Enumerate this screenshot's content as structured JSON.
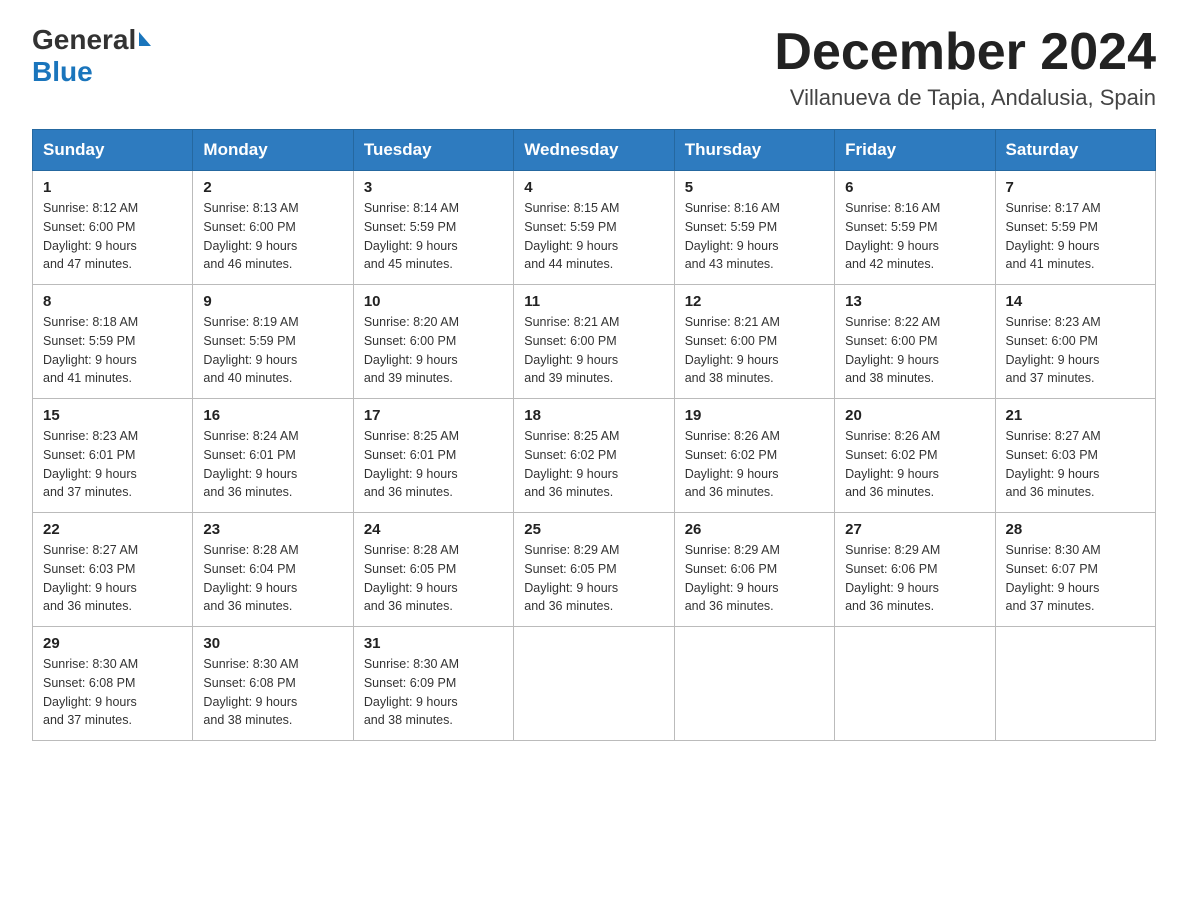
{
  "header": {
    "logo_general": "General",
    "logo_blue": "Blue",
    "month_title": "December 2024",
    "location": "Villanueva de Tapia, Andalusia, Spain"
  },
  "columns": [
    "Sunday",
    "Monday",
    "Tuesday",
    "Wednesday",
    "Thursday",
    "Friday",
    "Saturday"
  ],
  "weeks": [
    [
      {
        "day": "1",
        "info": "Sunrise: 8:12 AM\nSunset: 6:00 PM\nDaylight: 9 hours\nand 47 minutes."
      },
      {
        "day": "2",
        "info": "Sunrise: 8:13 AM\nSunset: 6:00 PM\nDaylight: 9 hours\nand 46 minutes."
      },
      {
        "day": "3",
        "info": "Sunrise: 8:14 AM\nSunset: 5:59 PM\nDaylight: 9 hours\nand 45 minutes."
      },
      {
        "day": "4",
        "info": "Sunrise: 8:15 AM\nSunset: 5:59 PM\nDaylight: 9 hours\nand 44 minutes."
      },
      {
        "day": "5",
        "info": "Sunrise: 8:16 AM\nSunset: 5:59 PM\nDaylight: 9 hours\nand 43 minutes."
      },
      {
        "day": "6",
        "info": "Sunrise: 8:16 AM\nSunset: 5:59 PM\nDaylight: 9 hours\nand 42 minutes."
      },
      {
        "day": "7",
        "info": "Sunrise: 8:17 AM\nSunset: 5:59 PM\nDaylight: 9 hours\nand 41 minutes."
      }
    ],
    [
      {
        "day": "8",
        "info": "Sunrise: 8:18 AM\nSunset: 5:59 PM\nDaylight: 9 hours\nand 41 minutes."
      },
      {
        "day": "9",
        "info": "Sunrise: 8:19 AM\nSunset: 5:59 PM\nDaylight: 9 hours\nand 40 minutes."
      },
      {
        "day": "10",
        "info": "Sunrise: 8:20 AM\nSunset: 6:00 PM\nDaylight: 9 hours\nand 39 minutes."
      },
      {
        "day": "11",
        "info": "Sunrise: 8:21 AM\nSunset: 6:00 PM\nDaylight: 9 hours\nand 39 minutes."
      },
      {
        "day": "12",
        "info": "Sunrise: 8:21 AM\nSunset: 6:00 PM\nDaylight: 9 hours\nand 38 minutes."
      },
      {
        "day": "13",
        "info": "Sunrise: 8:22 AM\nSunset: 6:00 PM\nDaylight: 9 hours\nand 38 minutes."
      },
      {
        "day": "14",
        "info": "Sunrise: 8:23 AM\nSunset: 6:00 PM\nDaylight: 9 hours\nand 37 minutes."
      }
    ],
    [
      {
        "day": "15",
        "info": "Sunrise: 8:23 AM\nSunset: 6:01 PM\nDaylight: 9 hours\nand 37 minutes."
      },
      {
        "day": "16",
        "info": "Sunrise: 8:24 AM\nSunset: 6:01 PM\nDaylight: 9 hours\nand 36 minutes."
      },
      {
        "day": "17",
        "info": "Sunrise: 8:25 AM\nSunset: 6:01 PM\nDaylight: 9 hours\nand 36 minutes."
      },
      {
        "day": "18",
        "info": "Sunrise: 8:25 AM\nSunset: 6:02 PM\nDaylight: 9 hours\nand 36 minutes."
      },
      {
        "day": "19",
        "info": "Sunrise: 8:26 AM\nSunset: 6:02 PM\nDaylight: 9 hours\nand 36 minutes."
      },
      {
        "day": "20",
        "info": "Sunrise: 8:26 AM\nSunset: 6:02 PM\nDaylight: 9 hours\nand 36 minutes."
      },
      {
        "day": "21",
        "info": "Sunrise: 8:27 AM\nSunset: 6:03 PM\nDaylight: 9 hours\nand 36 minutes."
      }
    ],
    [
      {
        "day": "22",
        "info": "Sunrise: 8:27 AM\nSunset: 6:03 PM\nDaylight: 9 hours\nand 36 minutes."
      },
      {
        "day": "23",
        "info": "Sunrise: 8:28 AM\nSunset: 6:04 PM\nDaylight: 9 hours\nand 36 minutes."
      },
      {
        "day": "24",
        "info": "Sunrise: 8:28 AM\nSunset: 6:05 PM\nDaylight: 9 hours\nand 36 minutes."
      },
      {
        "day": "25",
        "info": "Sunrise: 8:29 AM\nSunset: 6:05 PM\nDaylight: 9 hours\nand 36 minutes."
      },
      {
        "day": "26",
        "info": "Sunrise: 8:29 AM\nSunset: 6:06 PM\nDaylight: 9 hours\nand 36 minutes."
      },
      {
        "day": "27",
        "info": "Sunrise: 8:29 AM\nSunset: 6:06 PM\nDaylight: 9 hours\nand 36 minutes."
      },
      {
        "day": "28",
        "info": "Sunrise: 8:30 AM\nSunset: 6:07 PM\nDaylight: 9 hours\nand 37 minutes."
      }
    ],
    [
      {
        "day": "29",
        "info": "Sunrise: 8:30 AM\nSunset: 6:08 PM\nDaylight: 9 hours\nand 37 minutes."
      },
      {
        "day": "30",
        "info": "Sunrise: 8:30 AM\nSunset: 6:08 PM\nDaylight: 9 hours\nand 38 minutes."
      },
      {
        "day": "31",
        "info": "Sunrise: 8:30 AM\nSunset: 6:09 PM\nDaylight: 9 hours\nand 38 minutes."
      },
      null,
      null,
      null,
      null
    ]
  ]
}
